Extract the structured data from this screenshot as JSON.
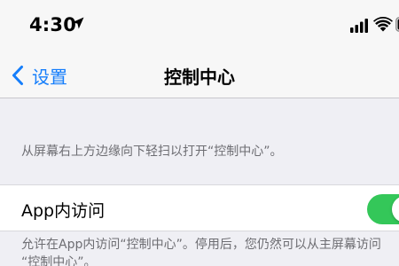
{
  "status_bar": {
    "time": "4:30",
    "location_icon": "location-arrow-icon",
    "signal_icon": "cellular-signal-icon",
    "wifi_icon": "wifi-icon",
    "battery_icon": "battery-icon"
  },
  "nav": {
    "back_label": "设置",
    "back_icon": "chevron-left-icon",
    "title": "控制中心"
  },
  "section": {
    "description": "从屏幕右上方边缘向下轻扫以打开“控制中心”。"
  },
  "setting": {
    "label": "App内访问",
    "enabled": true,
    "footer": "允许在App内访问“控制中心”。停用后，您仍然可以从主屏幕访问\n“控制中心”。"
  },
  "colors": {
    "accent": "#157efb",
    "toggle_on": "#34c759",
    "secondary_text": "#6d6d72",
    "background": "#efeff4"
  }
}
